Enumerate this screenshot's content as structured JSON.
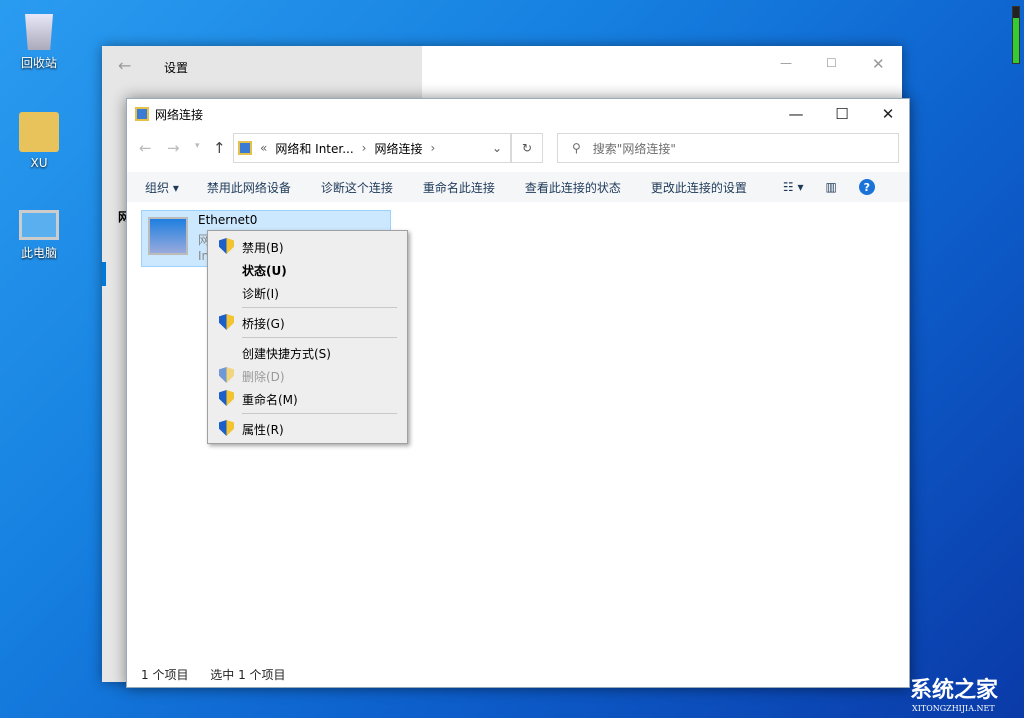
{
  "desktop": {
    "icons": [
      {
        "label": "回收站"
      },
      {
        "label": "XU"
      },
      {
        "label": "此电脑"
      }
    ],
    "watermark": {
      "cn": "系统之家",
      "en": "XITONGZHIJIA.NET"
    }
  },
  "settings": {
    "title": "设置",
    "left_letters": "网"
  },
  "explorer": {
    "title": "网络连接",
    "address": {
      "prefix": "«",
      "crumbs": [
        "网络和 Inter...",
        "网络连接"
      ]
    },
    "search_placeholder": "搜索\"网络连接\"",
    "toolbar": [
      "组织 ▾",
      "禁用此网络设备",
      "诊断这个连接",
      "重命名此连接",
      "查看此连接的状态",
      "更改此连接的设置"
    ],
    "item": {
      "name": "Ethernet0",
      "line2": "网",
      "line3": "In"
    },
    "status": {
      "count": "1 个项目",
      "selected": "选中 1 个项目"
    }
  },
  "context_menu": [
    {
      "label": "禁用(B)",
      "shield": true
    },
    {
      "label": "状态(U)",
      "bold": true
    },
    {
      "label": "诊断(I)"
    },
    {
      "label": "桥接(G)",
      "shield": true
    },
    {
      "label": "创建快捷方式(S)"
    },
    {
      "label": "删除(D)",
      "shield": true,
      "disabled": true
    },
    {
      "label": "重命名(M)",
      "shield": true
    },
    {
      "label": "属性(R)",
      "shield": true
    }
  ]
}
